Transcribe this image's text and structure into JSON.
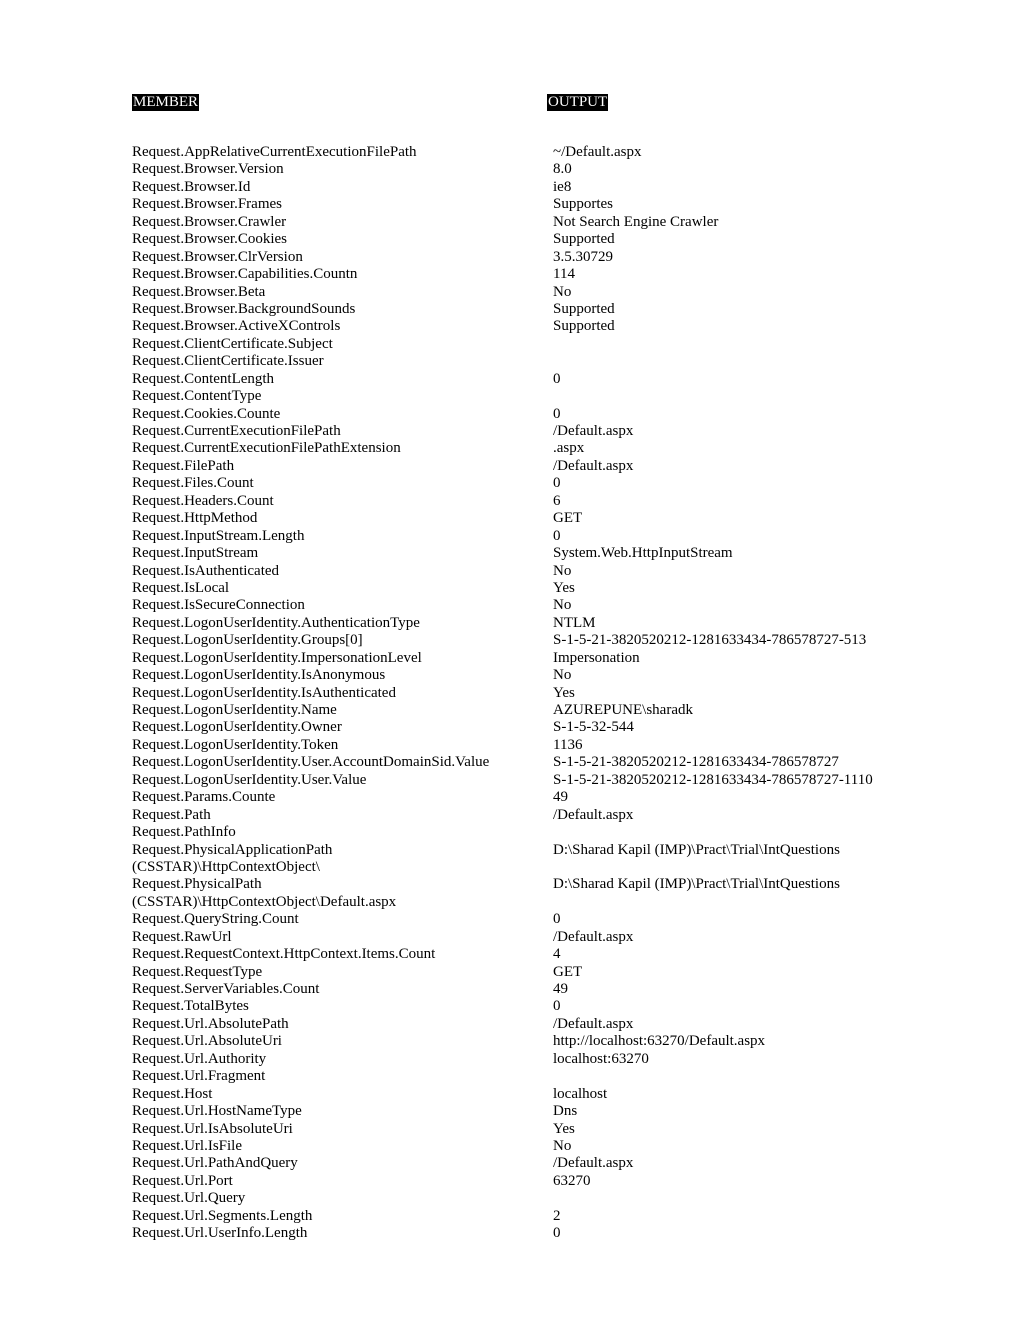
{
  "table": {
    "headers": {
      "member": "MEMBER",
      "output": "OUTPUT"
    },
    "rows": [
      {
        "member": "Request.AppRelativeCurrentExecutionFilePath",
        "value": "~/Default.aspx"
      },
      {
        "member": "Request.Browser.Version",
        "value": "8.0"
      },
      {
        "member": "Request.Browser.Id",
        "value": "ie8"
      },
      {
        "member": "Request.Browser.Frames",
        "value": "Supportes"
      },
      {
        "member": "Request.Browser.Crawler",
        "value": "Not Search Engine Crawler"
      },
      {
        "member": "Request.Browser.Cookies",
        "value": "Supported"
      },
      {
        "member": "Request.Browser.ClrVersion",
        "value": "3.5.30729"
      },
      {
        "member": "Request.Browser.Capabilities.Countn",
        "value": "114"
      },
      {
        "member": "Request.Browser.Beta",
        "value": "No"
      },
      {
        "member": "Request.Browser.BackgroundSounds",
        "value": "Supported"
      },
      {
        "member": "Request.Browser.ActiveXControls",
        "value": "Supported"
      },
      {
        "member": "Request.ClientCertificate.Subject",
        "value": ""
      },
      {
        "member": "Request.ClientCertificate.Issuer",
        "value": ""
      },
      {
        "member": "Request.ContentLength",
        "value": "0"
      },
      {
        "member": "Request.ContentType",
        "value": ""
      },
      {
        "member": "Request.Cookies.Counte",
        "value": "0"
      },
      {
        "member": "Request.CurrentExecutionFilePath",
        "value": "/Default.aspx"
      },
      {
        "member": "Request.CurrentExecutionFilePathExtension",
        "value": ".aspx"
      },
      {
        "member": "Request.FilePath",
        "value": "/Default.aspx"
      },
      {
        "member": "Request.Files.Count",
        "value": "0"
      },
      {
        "member": "Request.Headers.Count",
        "value": "6"
      },
      {
        "member": "Request.HttpMethod",
        "value": "GET"
      },
      {
        "member": "Request.InputStream.Length",
        "value": "0"
      },
      {
        "member": "Request.InputStream",
        "value": "System.Web.HttpInputStream"
      },
      {
        "member": "Request.IsAuthenticated",
        "value": "No"
      },
      {
        "member": "Request.IsLocal",
        "value": "Yes"
      },
      {
        "member": "Request.IsSecureConnection",
        "value": "No"
      },
      {
        "member": "Request.LogonUserIdentity.AuthenticationType",
        "value": "NTLM"
      },
      {
        "member": "Request.LogonUserIdentity.Groups[0]",
        "value": "S-1-5-21-3820520212-1281633434-786578727-513"
      },
      {
        "member": "Request.LogonUserIdentity.ImpersonationLevel",
        "value": "Impersonation"
      },
      {
        "member": "Request.LogonUserIdentity.IsAnonymous",
        "value": "No"
      },
      {
        "member": "Request.LogonUserIdentity.IsAuthenticated",
        "value": "Yes"
      },
      {
        "member": "Request.LogonUserIdentity.Name",
        "value": "AZUREPUNE\\sharadk"
      },
      {
        "member": "Request.LogonUserIdentity.Owner",
        "value": "S-1-5-32-544"
      },
      {
        "member": "Request.LogonUserIdentity.Token",
        "value": "1136"
      },
      {
        "member": "Request.LogonUserIdentity.User.AccountDomainSid.Value",
        "value": "S-1-5-21-3820520212-1281633434-786578727"
      },
      {
        "member": "Request.LogonUserIdentity.User.Value",
        "value": "S-1-5-21-3820520212-1281633434-786578727-1110"
      },
      {
        "member": "Request.Params.Counte",
        "value": "49"
      },
      {
        "member": "Request.Path",
        "value": "/Default.aspx"
      },
      {
        "member": "Request.PathInfo",
        "value": ""
      },
      {
        "member": "Request.PhysicalApplicationPath",
        "value": "D:\\Sharad Kapil (IMP)\\Pract\\Trial\\IntQuestions"
      },
      {
        "member": "(CSSTAR)\\HttpContextObject\\",
        "value": "",
        "continuation": true
      },
      {
        "member": "Request.PhysicalPath",
        "value": "D:\\Sharad Kapil (IMP)\\Pract\\Trial\\IntQuestions"
      },
      {
        "member": "(CSSTAR)\\HttpContextObject\\Default.aspx",
        "value": "",
        "continuation": true
      },
      {
        "member": "Request.QueryString.Count",
        "value": "0"
      },
      {
        "member": "Request.RawUrl",
        "value": "/Default.aspx"
      },
      {
        "member": "Request.RequestContext.HttpContext.Items.Count",
        "value": "4"
      },
      {
        "member": "Request.RequestType",
        "value": "GET"
      },
      {
        "member": "Request.ServerVariables.Count",
        "value": "49"
      },
      {
        "member": "Request.TotalBytes",
        "value": "0"
      },
      {
        "member": "Request.Url.AbsolutePath",
        "value": "/Default.aspx"
      },
      {
        "member": "Request.Url.AbsoluteUri",
        "value": "http://localhost:63270/Default.aspx"
      },
      {
        "member": "Request.Url.Authority",
        "value": "localhost:63270"
      },
      {
        "member": "Request.Url.Fragment",
        "value": ""
      },
      {
        "member": "Request.Host",
        "value": "localhost"
      },
      {
        "member": "Request.Url.HostNameType",
        "value": "Dns"
      },
      {
        "member": "Request.Url.IsAbsoluteUri",
        "value": "Yes"
      },
      {
        "member": "Request.Url.IsFile",
        "value": "No"
      },
      {
        "member": "Request.Url.PathAndQuery",
        "value": "/Default.aspx"
      },
      {
        "member": "Request.Url.Port",
        "value": "63270"
      },
      {
        "member": "Request.Url.Query",
        "value": ""
      },
      {
        "member": "Request.Url.Segments.Length",
        "value": "2"
      },
      {
        "member": "Request.Url.UserInfo.Length",
        "value": "0"
      }
    ]
  }
}
